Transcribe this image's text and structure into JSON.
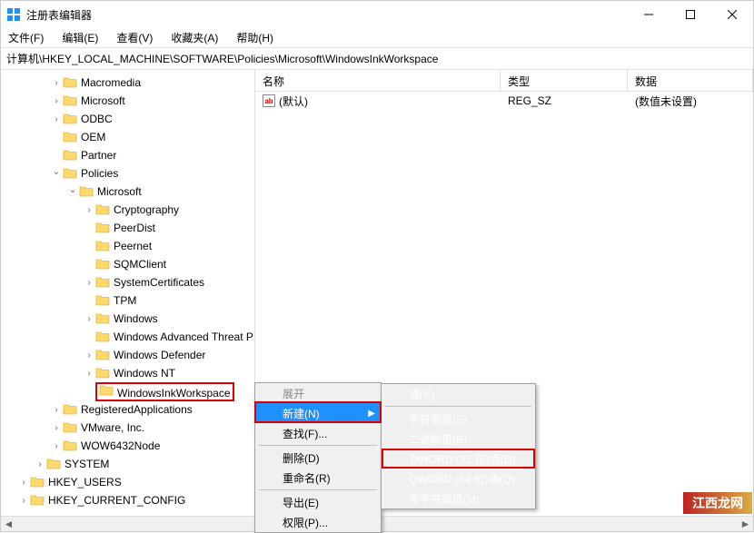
{
  "window": {
    "title": "注册表编辑器"
  },
  "menus": {
    "file": "文件(F)",
    "edit": "编辑(E)",
    "view": "查看(V)",
    "favorites": "收藏夹(A)",
    "help": "帮助(H)"
  },
  "address": "计算机\\HKEY_LOCAL_MACHINE\\SOFTWARE\\Policies\\Microsoft\\WindowsInkWorkspace",
  "columns": {
    "name": "名称",
    "type": "类型",
    "data": "数据"
  },
  "list": {
    "default_name": "(默认)",
    "default_type": "REG_SZ",
    "default_data": "(数值未设置)"
  },
  "tree": {
    "items": [
      {
        "indent": 3,
        "caret": ">",
        "label": "Macromedia"
      },
      {
        "indent": 3,
        "caret": ">",
        "label": "Microsoft"
      },
      {
        "indent": 3,
        "caret": ">",
        "label": "ODBC"
      },
      {
        "indent": 3,
        "caret": "",
        "label": "OEM"
      },
      {
        "indent": 3,
        "caret": "",
        "label": "Partner"
      },
      {
        "indent": 3,
        "caret": "v",
        "label": "Policies"
      },
      {
        "indent": 4,
        "caret": "v",
        "label": "Microsoft"
      },
      {
        "indent": 5,
        "caret": ">",
        "label": "Cryptography"
      },
      {
        "indent": 5,
        "caret": "",
        "label": "PeerDist"
      },
      {
        "indent": 5,
        "caret": "",
        "label": "Peernet"
      },
      {
        "indent": 5,
        "caret": "",
        "label": "SQMClient"
      },
      {
        "indent": 5,
        "caret": ">",
        "label": "SystemCertificates"
      },
      {
        "indent": 5,
        "caret": "",
        "label": "TPM"
      },
      {
        "indent": 5,
        "caret": ">",
        "label": "Windows"
      },
      {
        "indent": 5,
        "caret": "",
        "label": "Windows Advanced Threat P"
      },
      {
        "indent": 5,
        "caret": ">",
        "label": "Windows Defender"
      },
      {
        "indent": 5,
        "caret": ">",
        "label": "Windows NT"
      },
      {
        "indent": 5,
        "caret": "",
        "label": "WindowsInkWorkspace",
        "selected": true
      },
      {
        "indent": 3,
        "caret": ">",
        "label": "RegisteredApplications"
      },
      {
        "indent": 3,
        "caret": ">",
        "label": "VMware, Inc."
      },
      {
        "indent": 3,
        "caret": ">",
        "label": "WOW6432Node"
      },
      {
        "indent": 2,
        "caret": ">",
        "label": "SYSTEM"
      },
      {
        "indent": 1,
        "caret": ">",
        "label": "HKEY_USERS"
      },
      {
        "indent": 1,
        "caret": ">",
        "label": "HKEY_CURRENT_CONFIG"
      }
    ]
  },
  "context_menu": {
    "expand": "展开",
    "new": "新建(N)",
    "find": "查找(F)...",
    "delete": "删除(D)",
    "rename": "重命名(R)",
    "export": "导出(E)",
    "permissions": "权限(P)..."
  },
  "submenu": {
    "key": "项(K)",
    "string": "字符串值(S)",
    "binary": "二进制值(B)",
    "dword": "DWORD (32 位)值(D)",
    "qword": "QWORD (64 位)值(Q)",
    "multi": "多字符串值(M)"
  },
  "watermark": "江西龙网"
}
